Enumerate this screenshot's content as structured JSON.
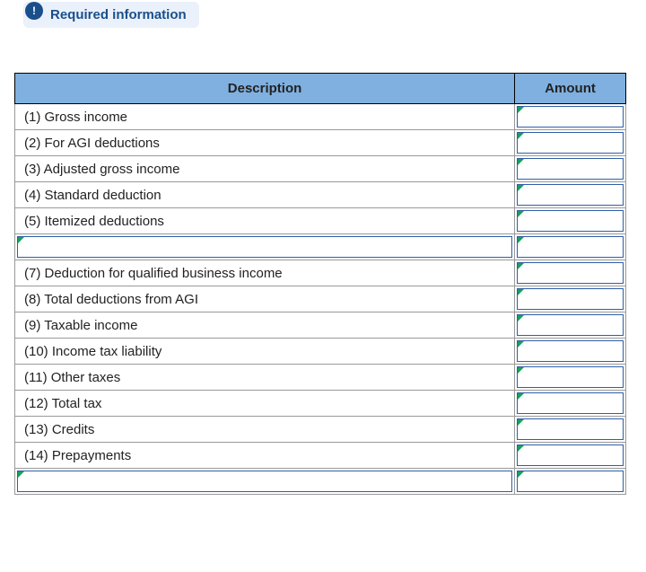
{
  "header": {
    "required_label": "Required information",
    "icon_glyph": "!"
  },
  "table": {
    "headers": {
      "description": "Description",
      "amount": "Amount"
    },
    "rows": [
      {
        "desc": "(1) Gross income",
        "desc_editable": false,
        "section_end": false
      },
      {
        "desc": "(2) For AGI deductions",
        "desc_editable": false,
        "section_end": true
      },
      {
        "desc": "(3) Adjusted gross income",
        "desc_editable": false,
        "section_end": false
      },
      {
        "desc": "(4) Standard deduction",
        "desc_editable": false,
        "section_end": false
      },
      {
        "desc": "(5) Itemized deductions",
        "desc_editable": false,
        "section_end": true
      },
      {
        "desc": "",
        "desc_editable": true,
        "section_end": true
      },
      {
        "desc": "(7) Deduction for qualified business income",
        "desc_editable": false,
        "section_end": false
      },
      {
        "desc": "(8) Total deductions from AGI",
        "desc_editable": false,
        "section_end": true
      },
      {
        "desc": "(9) Taxable income",
        "desc_editable": false,
        "section_end": true
      },
      {
        "desc": "(10) Income tax liability",
        "desc_editable": false,
        "section_end": false
      },
      {
        "desc": "(11) Other taxes",
        "desc_editable": false,
        "section_end": false
      },
      {
        "desc": "(12) Total tax",
        "desc_editable": false,
        "section_end": false
      },
      {
        "desc": "(13) Credits",
        "desc_editable": false,
        "section_end": false
      },
      {
        "desc": "(14) Prepayments",
        "desc_editable": false,
        "section_end": true
      },
      {
        "desc": "",
        "desc_editable": true,
        "section_end": false
      }
    ]
  }
}
